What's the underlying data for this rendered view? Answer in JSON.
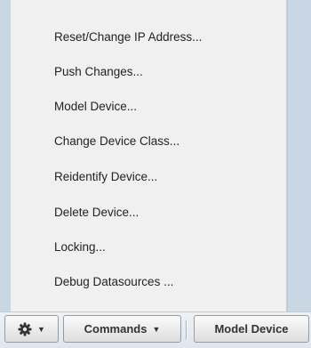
{
  "menu": {
    "items": [
      {
        "label": "Reset/Change IP Address..."
      },
      {
        "label": "Push Changes..."
      },
      {
        "label": "Model Device..."
      },
      {
        "label": "Change Device Class..."
      },
      {
        "label": "Reidentify Device..."
      },
      {
        "label": "Delete Device..."
      },
      {
        "label": "Locking..."
      },
      {
        "label": "Debug Datasources ..."
      }
    ]
  },
  "toolbar": {
    "gear_icon": "gear-icon",
    "caret_icon": "caret-down-icon",
    "commands_label": "Commands",
    "model_device_label": "Model Device"
  }
}
